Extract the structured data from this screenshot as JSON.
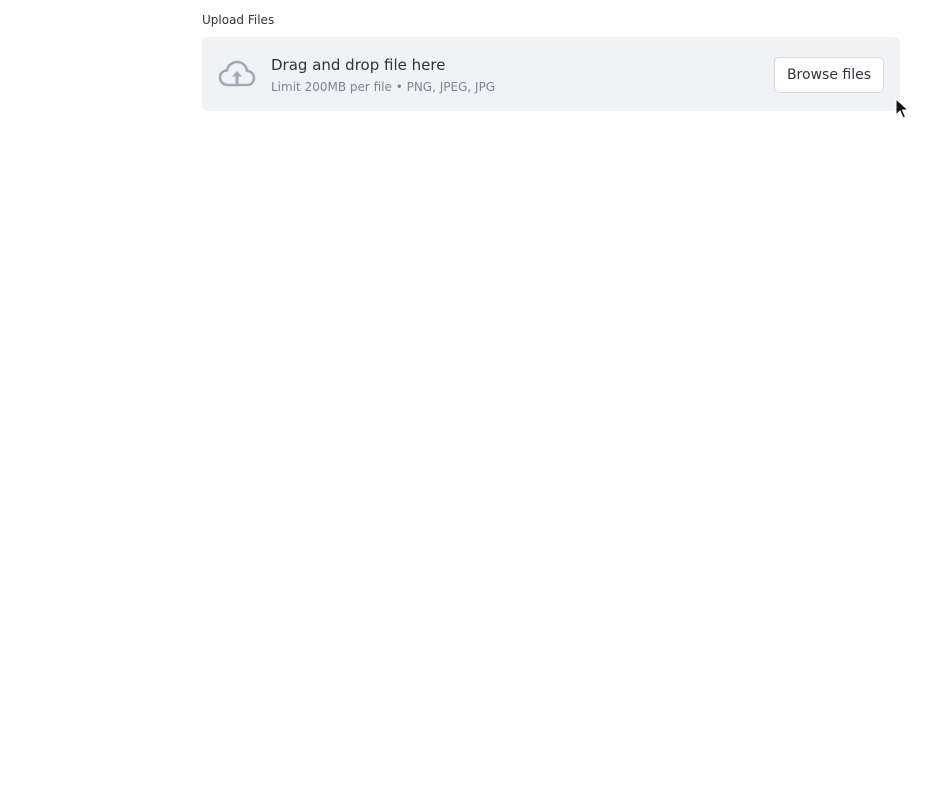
{
  "uploader": {
    "label": "Upload Files",
    "drop_title": "Drag and drop file here",
    "limit_text": "Limit 200MB per file • PNG, JPEG, JPG",
    "browse_label": "Browse files",
    "icon": "cloud-upload-icon"
  },
  "colors": {
    "dropzone_bg": "#F0F2F6",
    "text": "#31333F",
    "muted_text": "#808495",
    "icon": "#A3A8B8"
  }
}
